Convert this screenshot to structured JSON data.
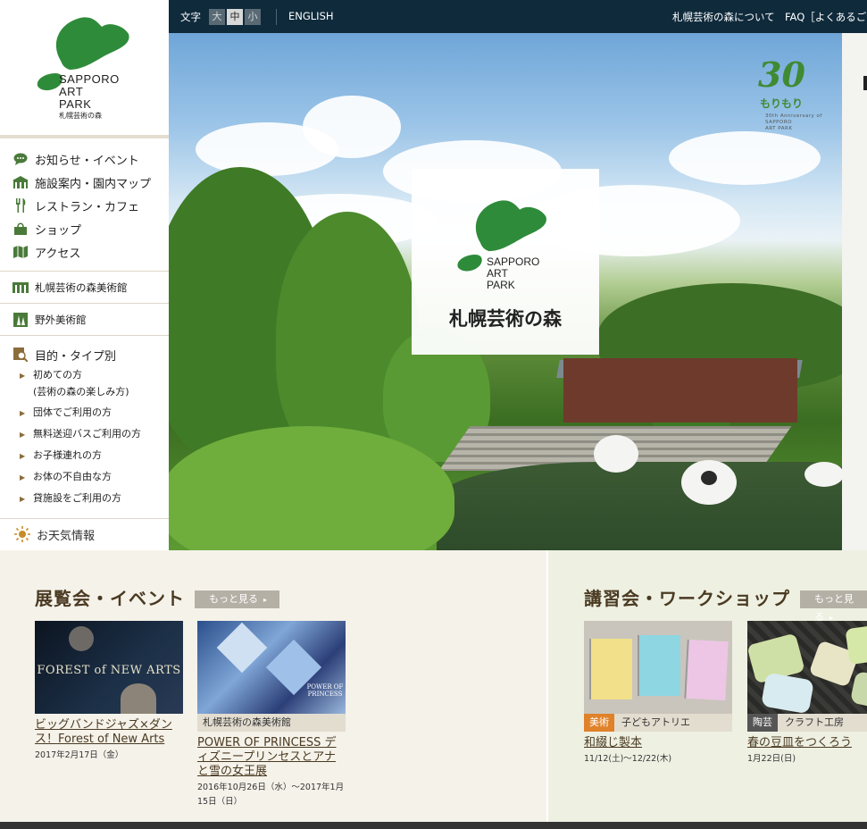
{
  "logo": {
    "line1": "SAPPORO",
    "line2": "ART",
    "line3": "PARK",
    "jp": "札幌芸術の森"
  },
  "nav": {
    "main": [
      {
        "label": "お知らせ・イベント",
        "icon": "speech-bubble-icon"
      },
      {
        "label": "施設案内・園内マップ",
        "icon": "building-icon"
      },
      {
        "label": "レストラン・カフェ",
        "icon": "fork-knife-icon"
      },
      {
        "label": "ショップ",
        "icon": "shopping-bag-icon"
      },
      {
        "label": "アクセス",
        "icon": "map-icon"
      }
    ],
    "museum": "札幌芸術の森美術館",
    "outdoor": "野外美術館",
    "purpose_title": "目的・タイプ別",
    "purpose_items": [
      "初めての方\n(芸術の森の楽しみ方)",
      "団体でご利用の方",
      "無料送迎バスご利用の方",
      "お子様連れの方",
      "お体の不自由な方",
      "貸施設をご利用の方"
    ],
    "weather": "お天気情報"
  },
  "topbar": {
    "text_size_label": "文字",
    "sizes": [
      "大",
      "中",
      "小"
    ],
    "english": "ENGLISH",
    "about": "札幌芸術の森について",
    "faq": "FAQ［よくあるご質問"
  },
  "hero": {
    "logo_line1": "SAPPORO",
    "logo_line2": "ART",
    "logo_line3": "PARK",
    "logo_jp": "札幌芸術の森",
    "anniv_num": "30",
    "anniv_jp": "もりもり",
    "anniv_en_1": "30th Anniversary of",
    "anniv_en_2": "SAPPORO",
    "anniv_en_3": "ART PARK"
  },
  "events": {
    "title": "展覧会・イベント",
    "more": "もっと見る",
    "items": [
      {
        "thumb_text": "FOREST of NEW ARTS",
        "title": "ビッグバンドジャズ×ダンス！Forest of New Arts",
        "date": "2017年2月17日（金）"
      },
      {
        "venue": "札幌芸術の森美術館",
        "thumb_text": "POWER OF PRINCESS",
        "title": "POWER OF PRINCESS ディズニープリンセスとアナと雪の女王展",
        "date": "2016年10月26日（水）～2017年1月15日（日）"
      }
    ]
  },
  "workshops": {
    "title": "講習会・ワークショップ",
    "more": "もっと見る",
    "items": [
      {
        "tag": "美術",
        "tag_color": "#e0822a",
        "place": "子どもアトリエ",
        "title": "和綴じ製本",
        "date": "11/12(土)～12/22(木)"
      },
      {
        "tag": "陶芸",
        "tag_color": "#555555",
        "place": "クラフト工房",
        "title": "春の豆皿をつくろう",
        "date": "1月22日(日)"
      }
    ]
  },
  "colors": {
    "topbar": "#0f2a3b",
    "brand_green": "#2e7d32",
    "heading_brown": "#4a3a22"
  }
}
